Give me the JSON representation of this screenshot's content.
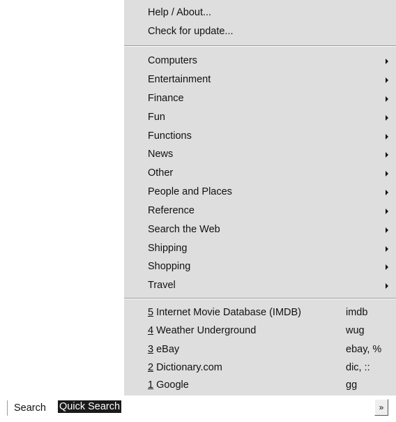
{
  "menu": {
    "top_items": [
      {
        "label": "Help / About..."
      },
      {
        "label": "Check for update..."
      }
    ],
    "categories": [
      {
        "label": "Computers"
      },
      {
        "label": "Entertainment"
      },
      {
        "label": "Finance"
      },
      {
        "label": "Fun"
      },
      {
        "label": "Functions"
      },
      {
        "label": "News"
      },
      {
        "label": "Other"
      },
      {
        "label": "People and Places"
      },
      {
        "label": "Reference"
      },
      {
        "label": "Search the Web"
      },
      {
        "label": "Shipping"
      },
      {
        "label": "Shopping"
      },
      {
        "label": "Travel"
      }
    ],
    "recent": [
      {
        "number": "5",
        "label": "Internet Movie Database (IMDB)",
        "keyword": "imdb"
      },
      {
        "number": "4",
        "label": "Weather Underground",
        "keyword": "wug"
      },
      {
        "number": "3",
        "label": "eBay",
        "keyword": "ebay, %"
      },
      {
        "number": "2",
        "label": "Dictionary.com",
        "keyword": "dic, ::"
      },
      {
        "number": "1",
        "label": "Google",
        "keyword": "gg"
      }
    ]
  },
  "search_bar": {
    "label": "Search",
    "value": "Quick Search",
    "go_label": "»"
  }
}
